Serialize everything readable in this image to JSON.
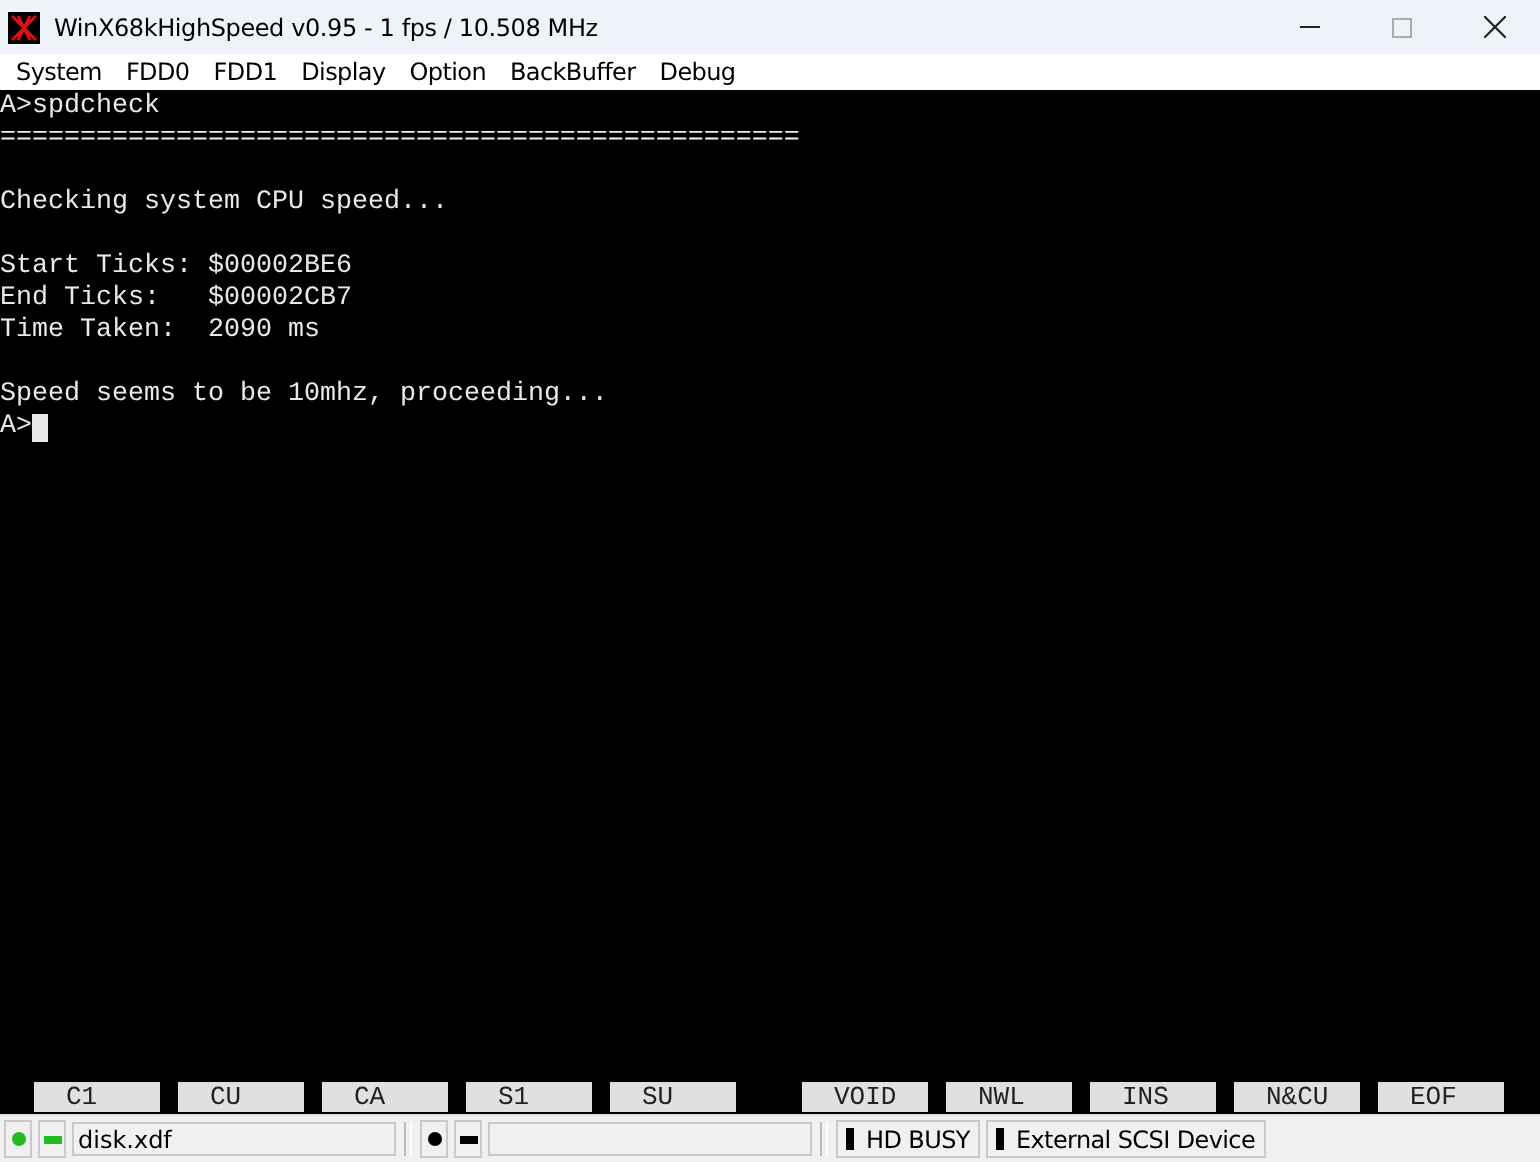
{
  "window": {
    "title": "WinX68kHighSpeed v0.95 - 1 fps / 10.508 MHz"
  },
  "menu": [
    "System",
    "FDD0",
    "FDD1",
    "Display",
    "Option",
    "BackBuffer",
    "Debug"
  ],
  "terminal": {
    "blocks": [
      [
        "A>spdcheck",
        "=================================================="
      ],
      [
        "Checking system CPU speed..."
      ],
      [
        "Start Ticks: $00002BE6",
        "End Ticks:   $00002CB7",
        "Time Taken:  2090 ms"
      ],
      [
        "Speed seems to be 10mhz, proceeding...",
        "A>"
      ]
    ],
    "cursor": true
  },
  "function_keys": {
    "left": [
      "C1",
      "CU",
      "CA",
      "S1",
      "SU"
    ],
    "right": [
      "VOID",
      "NWL",
      "INS",
      "N&CU",
      "EOF"
    ]
  },
  "status_bar": {
    "drives": [
      {
        "indicators": [
          {
            "kind": "dot",
            "color": "#22bb22"
          },
          {
            "kind": "dash",
            "color": "#22bb22"
          }
        ],
        "file": "disk.xdf"
      },
      {
        "indicators": [
          {
            "kind": "dot",
            "color": "#000000"
          },
          {
            "kind": "dash",
            "color": "#000000"
          }
        ]
      }
    ],
    "lamps": [
      {
        "label": "HD BUSY",
        "color": "#000000"
      },
      {
        "label": "External SCSI Device",
        "color": "#000000"
      }
    ]
  }
}
